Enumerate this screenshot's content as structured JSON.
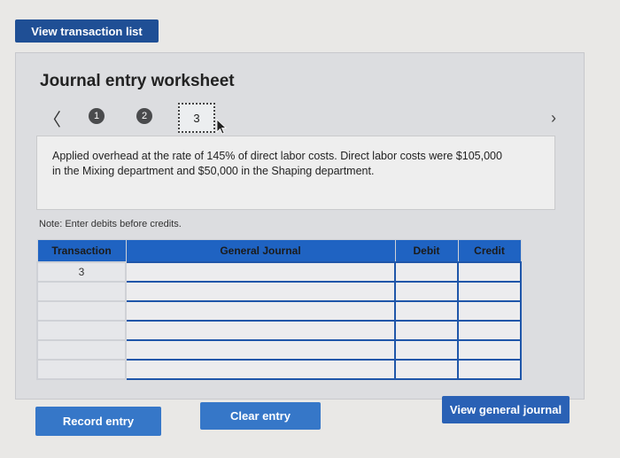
{
  "top": {
    "view_transaction_list": "View transaction list"
  },
  "worksheet": {
    "title": "Journal entry worksheet",
    "steps": [
      "1",
      "2",
      "3"
    ],
    "current_step": "3",
    "prev_icon": "chevron-left-icon",
    "next_icon": "chevron-right-icon",
    "description": "Applied overhead at the rate of 145% of direct labor costs. Direct labor costs were $105,000 in the Mixing department and $50,000 in the Shaping department.",
    "note": "Note: Enter debits before credits."
  },
  "table": {
    "headers": {
      "transaction": "Transaction",
      "general_journal": "General Journal",
      "debit": "Debit",
      "credit": "Credit"
    },
    "rows": [
      {
        "transaction": "3",
        "account": "",
        "debit": "",
        "credit": ""
      },
      {
        "transaction": "",
        "account": "",
        "debit": "",
        "credit": ""
      },
      {
        "transaction": "",
        "account": "",
        "debit": "",
        "credit": ""
      },
      {
        "transaction": "",
        "account": "",
        "debit": "",
        "credit": ""
      },
      {
        "transaction": "",
        "account": "",
        "debit": "",
        "credit": ""
      },
      {
        "transaction": "",
        "account": "",
        "debit": "",
        "credit": ""
      }
    ]
  },
  "buttons": {
    "record_entry": "Record entry",
    "clear_entry": "Clear entry",
    "view_general_journal": "View general journal"
  },
  "colors": {
    "accent": "#2f6cc0",
    "header": "#1f63c2"
  }
}
